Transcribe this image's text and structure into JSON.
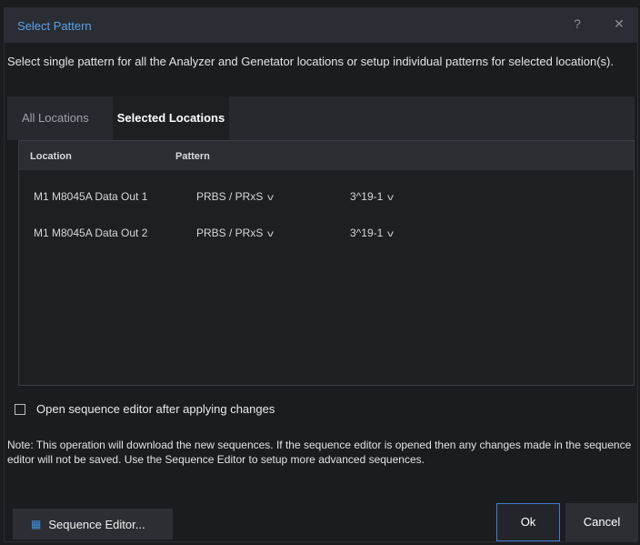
{
  "window": {
    "title": "Select Pattern",
    "help_glyph": "?",
    "close_glyph": "✕"
  },
  "description": "Select single pattern for all the Analyzer and Genetator locations or setup individual patterns for selected location(s).",
  "tabs": [
    {
      "label": "All Locations",
      "active": false
    },
    {
      "label": "Selected Locations",
      "active": true
    }
  ],
  "grid": {
    "columns": [
      "Location",
      "Pattern"
    ],
    "rows": [
      {
        "location": "M1 M8045A Data Out 1",
        "pattern": "PRBS / PRxS",
        "variant": "3^19-1"
      },
      {
        "location": "M1 M8045A Data Out 2",
        "pattern": "PRBS / PRxS",
        "variant": "3^19-1"
      }
    ]
  },
  "checkbox": {
    "label": "Open sequence editor after applying changes",
    "checked": false
  },
  "note": "Note: This operation will download the new sequences. If the sequence editor is opened then any changes made in the sequence editor will not be saved. Use the Sequence Editor to setup more advanced sequences.",
  "buttons": {
    "sequence_editor": "Sequence Editor...",
    "ok": "Ok",
    "cancel": "Cancel"
  },
  "icons": {
    "dropdown": "chevron-down-icon",
    "sequence_editor": "sequence-editor-icon"
  },
  "colors": {
    "accent": "#5aa0e6",
    "primary_border": "#3f7fcf"
  }
}
